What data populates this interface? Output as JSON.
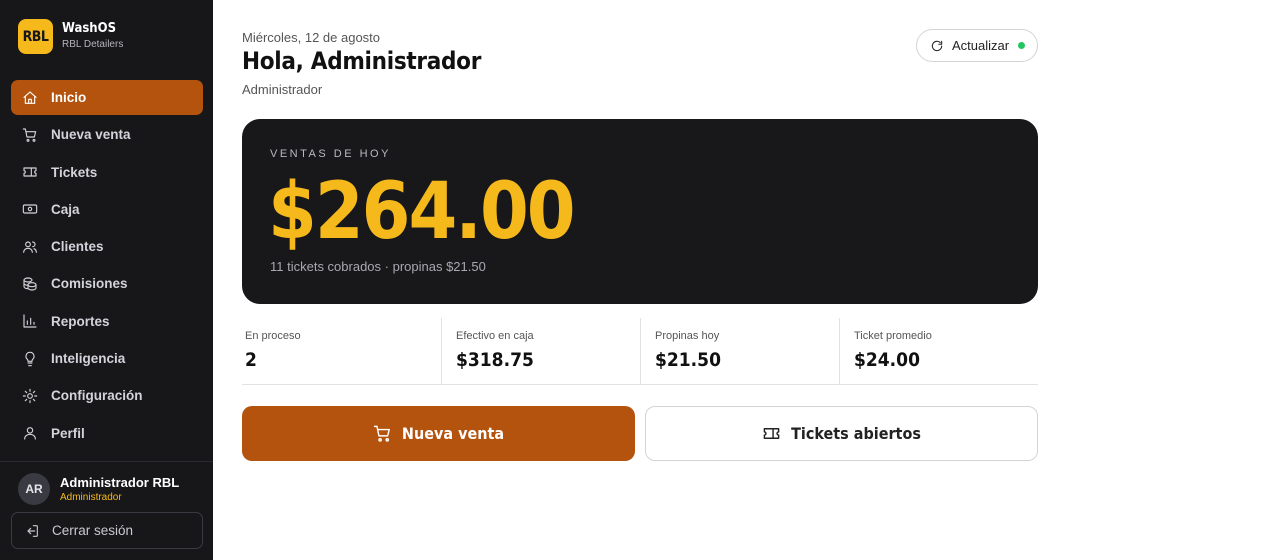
{
  "brand": {
    "logo_text": "RBL",
    "name": "WashOS",
    "subtitle": "RBL Detailers"
  },
  "nav": [
    {
      "label": "Inicio",
      "icon": "home-icon",
      "active": true
    },
    {
      "label": "Nueva venta",
      "icon": "cart-icon"
    },
    {
      "label": "Tickets",
      "icon": "ticket-icon"
    },
    {
      "label": "Caja",
      "icon": "cash-icon"
    },
    {
      "label": "Clientes",
      "icon": "users-icon"
    },
    {
      "label": "Comisiones",
      "icon": "coins-icon"
    },
    {
      "label": "Reportes",
      "icon": "chart-icon"
    },
    {
      "label": "Inteligencia",
      "icon": "lightbulb-icon"
    },
    {
      "label": "Configuración",
      "icon": "settings-icon"
    },
    {
      "label": "Perfil",
      "icon": "user-icon"
    }
  ],
  "user": {
    "initials": "AR",
    "name": "Administrador RBL",
    "role": "Administrador"
  },
  "logout_label": "Cerrar sesión",
  "header": {
    "date": "Miércoles, 12 de agosto",
    "greeting": "Hola, Administrador",
    "role": "Administrador",
    "refresh_label": "Actualizar"
  },
  "sales": {
    "label": "VENTAS DE HOY",
    "amount": "$264.00",
    "summary": "11 tickets cobrados · propinas $21.50"
  },
  "stats": [
    {
      "label": "En proceso",
      "value": "2"
    },
    {
      "label": "Efectivo en caja",
      "value": "$318.75"
    },
    {
      "label": "Propinas hoy",
      "value": "$21.50"
    },
    {
      "label": "Ticket promedio",
      "value": "$24.00"
    }
  ],
  "actions": {
    "new_sale": "Nueva venta",
    "open_tickets": "Tickets abiertos"
  },
  "colors": {
    "accent": "#b4530d",
    "highlight": "#f6b91c",
    "sidebar": "#17171a",
    "status_ok": "#22c55e"
  }
}
